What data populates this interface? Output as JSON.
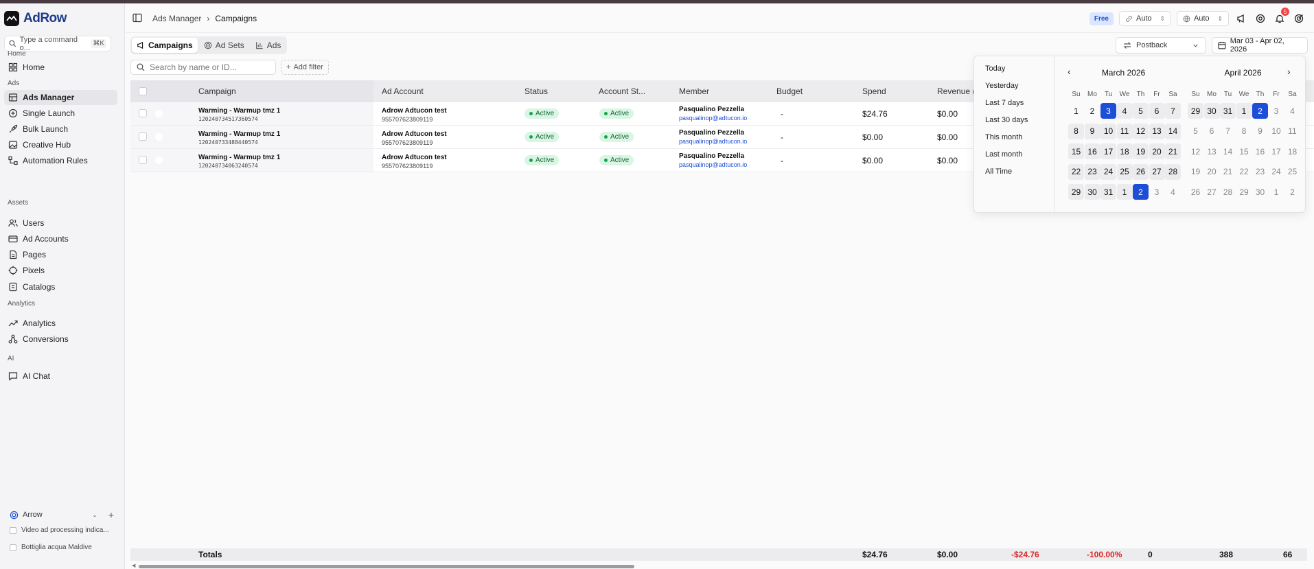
{
  "app": {
    "logo": "AdRow"
  },
  "sidebar": {
    "command_placeholder": "Type a command o...",
    "command_kbd": "⌘K",
    "sections": {
      "home": "Home",
      "ads": "Ads",
      "assets": "Assets",
      "analytics": "Analytics",
      "ai": "AI"
    },
    "items": [
      {
        "label": "Home",
        "icon": "dashboard-icon"
      },
      {
        "label": "Ads Manager",
        "icon": "table-icon"
      },
      {
        "label": "Single Launch",
        "icon": "plus-circle-icon"
      },
      {
        "label": "Bulk Launch",
        "icon": "rocket-icon"
      },
      {
        "label": "Creative Hub",
        "icon": "image-icon"
      },
      {
        "label": "Automation Rules",
        "icon": "flow-icon"
      },
      {
        "label": "Users",
        "icon": "users-icon"
      },
      {
        "label": "Ad Accounts",
        "icon": "card-icon"
      },
      {
        "label": "Pages",
        "icon": "page-icon"
      },
      {
        "label": "Pixels",
        "icon": "crosshair-icon"
      },
      {
        "label": "Catalogs",
        "icon": "catalog-icon"
      },
      {
        "label": "Analytics",
        "icon": "trend-icon"
      },
      {
        "label": "Conversions",
        "icon": "conversion-icon"
      },
      {
        "label": "AI Chat",
        "icon": "chat-icon"
      }
    ],
    "workspace": "Arrow",
    "recent": [
      "Video ad processing indica...",
      "Bottiglia acqua Maldive"
    ]
  },
  "header": {
    "breadcrumb_parent": "Ads Manager",
    "breadcrumb_current": "Campaigns",
    "plan_badge": "Free",
    "select1": "Auto",
    "select2": "Auto",
    "notif_count": "5"
  },
  "tabs": [
    "Campaigns",
    "Ad Sets",
    "Ads"
  ],
  "toolbar": {
    "search_placeholder": "Search by name or ID...",
    "add_filter": "Add filter",
    "attribution": "Postback",
    "date_range": "Mar 03 - Apr 02, 2026"
  },
  "table": {
    "columns": [
      "Campaign",
      "Ad Account",
      "Status",
      "Account St...",
      "Member",
      "Budget",
      "Spend",
      "Revenue ("
    ],
    "rows": [
      {
        "name": "Warming - Warmup tmz 1",
        "id": "120240734517360574",
        "account": "Adrow Adtucon test",
        "account_id": "955707623809119",
        "status": "Active",
        "account_status": "Active",
        "member": "Pasqualino Pezzella",
        "email": "pasqualinop@adtucon.io",
        "budget": "-",
        "spend": "$24.76",
        "revenue": "$0.00"
      },
      {
        "name": "Warming - Warmup tmz 1",
        "id": "120240733488440574",
        "account": "Adrow Adtucon test",
        "account_id": "955707623809119",
        "status": "Active",
        "account_status": "Active",
        "member": "Pasqualino Pezzella",
        "email": "pasqualinop@adtucon.io",
        "budget": "-",
        "spend": "$0.00",
        "revenue": "$0.00"
      },
      {
        "name": "Warming - Warmup tmz 1",
        "id": "120240734063240574",
        "account": "Adrow Adtucon test",
        "account_id": "955707623809119",
        "status": "Active",
        "account_status": "Active",
        "member": "Pasqualino Pezzella",
        "email": "pasqualinop@adtucon.io",
        "budget": "-",
        "spend": "$0.00",
        "revenue": "$0.00"
      }
    ],
    "totals": {
      "label": "Totals",
      "spend": "$24.76",
      "revenue": "$0.00",
      "profit": "-$24.76",
      "roi": "-100.00%",
      "v1": "0",
      "v2": "388",
      "v3": "66"
    }
  },
  "datepicker": {
    "presets": [
      "Today",
      "Yesterday",
      "Last 7 days",
      "Last 30 days",
      "This month",
      "Last month",
      "All Time"
    ],
    "weekdays": [
      "Su",
      "Mo",
      "Tu",
      "We",
      "Th",
      "Fr",
      "Sa"
    ],
    "months": [
      {
        "title": "March 2026",
        "weeks": [
          [
            "1",
            "2",
            "3",
            "4",
            "5",
            "6",
            "7"
          ],
          [
            "8",
            "9",
            "10",
            "11",
            "12",
            "13",
            "14"
          ],
          [
            "15",
            "16",
            "17",
            "18",
            "19",
            "20",
            "21"
          ],
          [
            "22",
            "23",
            "24",
            "25",
            "26",
            "27",
            "28"
          ],
          [
            "29",
            "30",
            "31",
            "1",
            "2",
            "3",
            "4"
          ]
        ],
        "start": [
          0,
          2
        ],
        "end": [
          4,
          4
        ],
        "inactive_after": [
          4,
          4
        ]
      },
      {
        "title": "April 2026",
        "weeks": [
          [
            "29",
            "30",
            "31",
            "1",
            "2",
            "3",
            "4"
          ],
          [
            "5",
            "6",
            "7",
            "8",
            "9",
            "10",
            "11"
          ],
          [
            "12",
            "13",
            "14",
            "15",
            "16",
            "17",
            "18"
          ],
          [
            "19",
            "20",
            "21",
            "22",
            "23",
            "24",
            "25"
          ],
          [
            "26",
            "27",
            "28",
            "29",
            "30",
            "1",
            "2"
          ]
        ],
        "start": null,
        "end": [
          0,
          4
        ],
        "inactive_after": [
          0,
          4
        ]
      }
    ]
  },
  "colors": {
    "accent": "#1d4ed8",
    "active_bg": "#d9f6e4",
    "negative": "#dc2626"
  }
}
